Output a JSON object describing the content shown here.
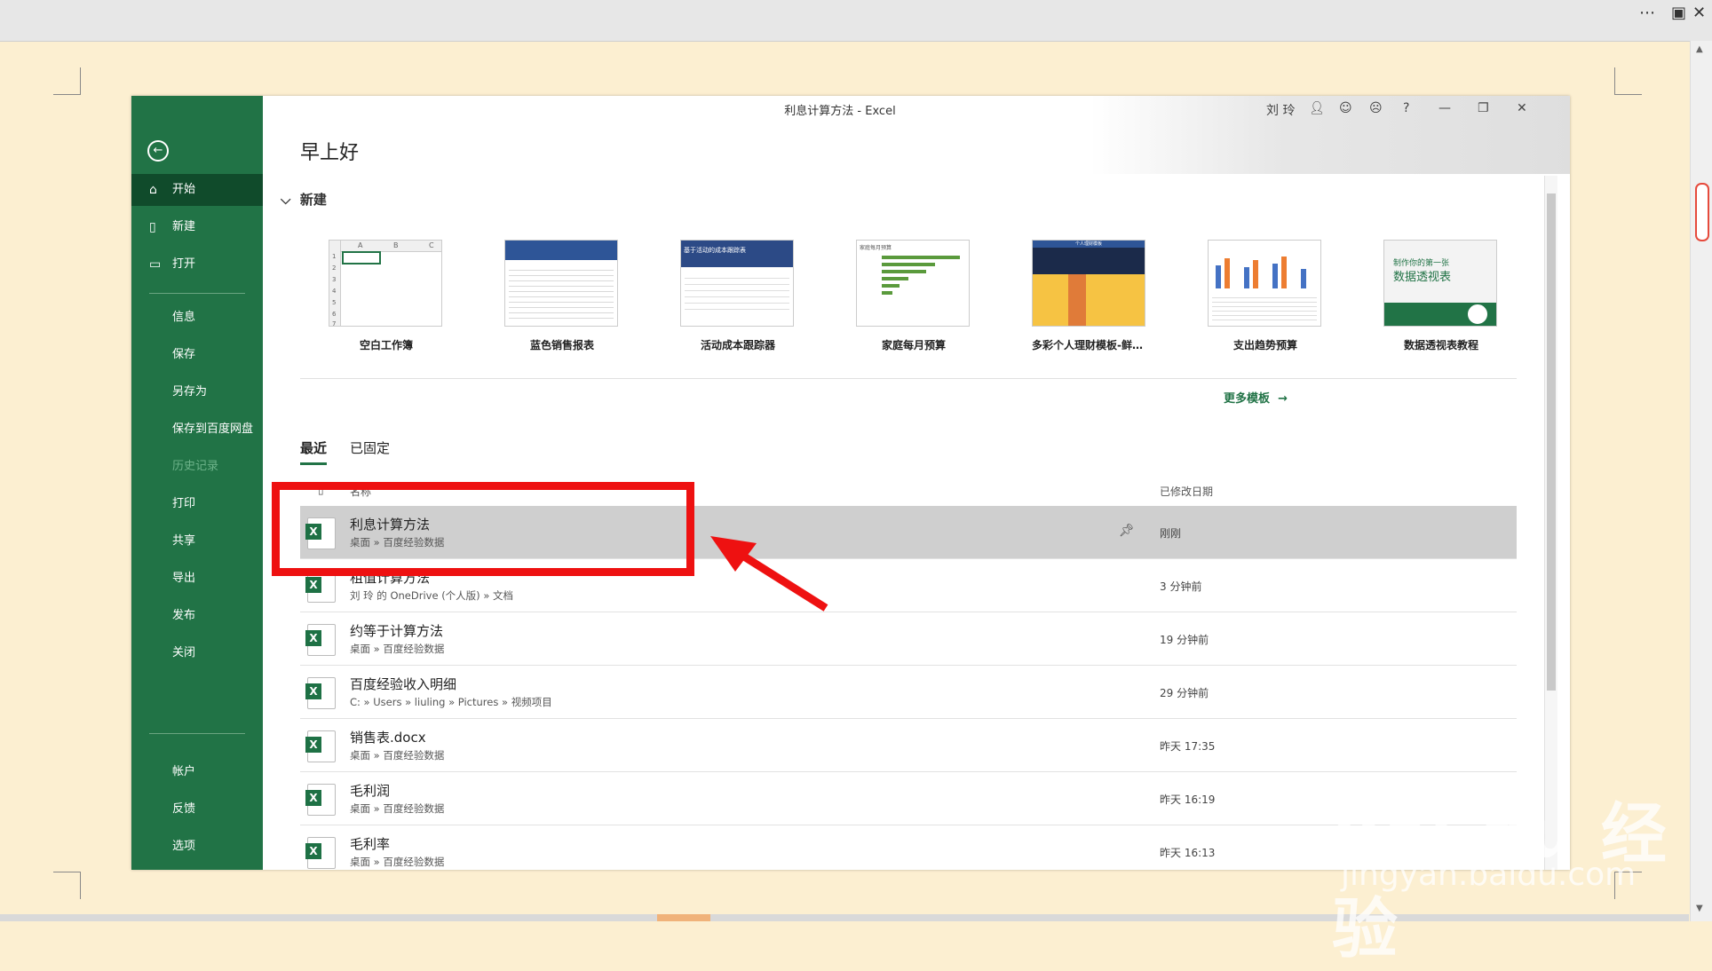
{
  "app": {
    "window_title": "利息计算方法  -  Excel",
    "user_name": "刘 玲",
    "greeting": "早上好"
  },
  "sidebar": {
    "items": [
      {
        "label": "开始",
        "icon": "home-icon",
        "active": true
      },
      {
        "label": "新建",
        "icon": "new-file-icon"
      },
      {
        "label": "打开",
        "icon": "open-folder-icon"
      },
      {
        "label": "信息"
      },
      {
        "label": "保存"
      },
      {
        "label": "另存为"
      },
      {
        "label": "保存到百度网盘"
      },
      {
        "label": "历史记录",
        "disabled": true
      },
      {
        "label": "打印"
      },
      {
        "label": "共享"
      },
      {
        "label": "导出"
      },
      {
        "label": "发布"
      },
      {
        "label": "关闭"
      },
      {
        "label": "帐户"
      },
      {
        "label": "反馈"
      },
      {
        "label": "选项"
      }
    ]
  },
  "new_section": {
    "title": "新建",
    "templates": [
      {
        "name": "空白工作簿"
      },
      {
        "name": "蓝色销售报表"
      },
      {
        "name": "活动成本跟踪器"
      },
      {
        "name": "家庭每月预算"
      },
      {
        "name": "多彩个人理财模板-鲜艳明..."
      },
      {
        "name": "支出趋势预算"
      },
      {
        "name": "数据透视表教程",
        "thumb_text_1": "制作你的第一张",
        "thumb_text_2": "数据透视表"
      }
    ],
    "more_link": "更多模板"
  },
  "thumb_texts": {
    "blank_cols": [
      "A",
      "B",
      "C"
    ],
    "blank_rows": [
      "1",
      "2",
      "3",
      "4",
      "5",
      "6",
      "7"
    ],
    "cost_tracker": "基于活动的成本跟踪表",
    "monthly_budget": "家庭每月预算",
    "personal_finance": "个人理财模板"
  },
  "recent": {
    "tabs": [
      "最近",
      "已固定"
    ],
    "col_name": "名称",
    "col_date": "已修改日期",
    "files": [
      {
        "name": "利息计算方法",
        "path": "桌面 » 百度经验数据",
        "date": "刚刚",
        "selected": true
      },
      {
        "name": "租值计算方法",
        "path": "刘 玲 的 OneDrive (个人版) » 文档",
        "date": "3 分钟前"
      },
      {
        "name": "约等于计算方法",
        "path": "桌面 » 百度经验数据",
        "date": "19 分钟前"
      },
      {
        "name": "百度经验收入明细",
        "path": "C: » Users » liuling » Pictures » 视频项目",
        "date": "29 分钟前"
      },
      {
        "name": "销售表.docx",
        "path": "桌面 » 百度经验数据",
        "date": "昨天 17:35"
      },
      {
        "name": "毛利润",
        "path": "桌面 » 百度经验数据",
        "date": "昨天 16:19"
      },
      {
        "name": "毛利率",
        "path": "桌面 » 百度经验数据",
        "date": "昨天 16:13"
      }
    ]
  },
  "watermark": {
    "brand": "Bai du 经验",
    "url": "jingyan.baidu.com"
  },
  "colors": {
    "excel_green": "#217346",
    "annotation_red": "#ee1111",
    "page_bg": "#fcefd1"
  }
}
